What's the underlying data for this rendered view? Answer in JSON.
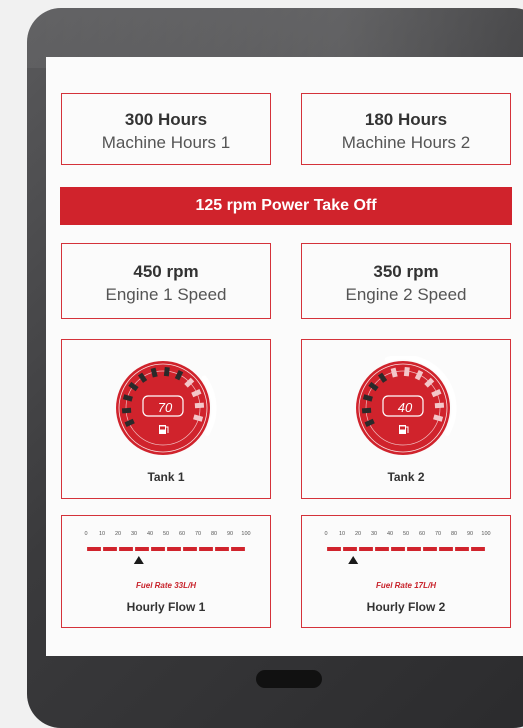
{
  "colors": {
    "accent": "#d0232c",
    "frame": "#3a3a3c",
    "screen": "#fbfbfb"
  },
  "machine_hours": [
    {
      "value": "300 Hours",
      "label": "Machine Hours 1"
    },
    {
      "value": "180 Hours",
      "label": "Machine Hours 2"
    }
  ],
  "pto_banner": "125 rpm Power Take Off",
  "engines": [
    {
      "value": "450 rpm",
      "label": "Engine 1 Speed"
    },
    {
      "value": "350 rpm",
      "label": "Engine 2 Speed"
    }
  ],
  "tanks": [
    {
      "reading": "70",
      "label": "Tank 1",
      "icon": "fuel-pump-icon",
      "level": 0.7
    },
    {
      "reading": "40",
      "label": "Tank 2",
      "icon": "fuel-pump-icon",
      "level": 0.4
    }
  ],
  "flows": [
    {
      "scale": [
        "0",
        "10",
        "20",
        "30",
        "40",
        "50",
        "60",
        "70",
        "80",
        "90",
        "100"
      ],
      "fuel_rate": "Fuel Rate 33L/H",
      "label": "Hourly Flow 1",
      "marker_value": 33
    },
    {
      "scale": [
        "0",
        "10",
        "20",
        "30",
        "40",
        "50",
        "60",
        "70",
        "80",
        "90",
        "100"
      ],
      "fuel_rate": "Fuel Rate 17L/H",
      "label": "Hourly Flow 2",
      "marker_value": 17
    }
  ]
}
